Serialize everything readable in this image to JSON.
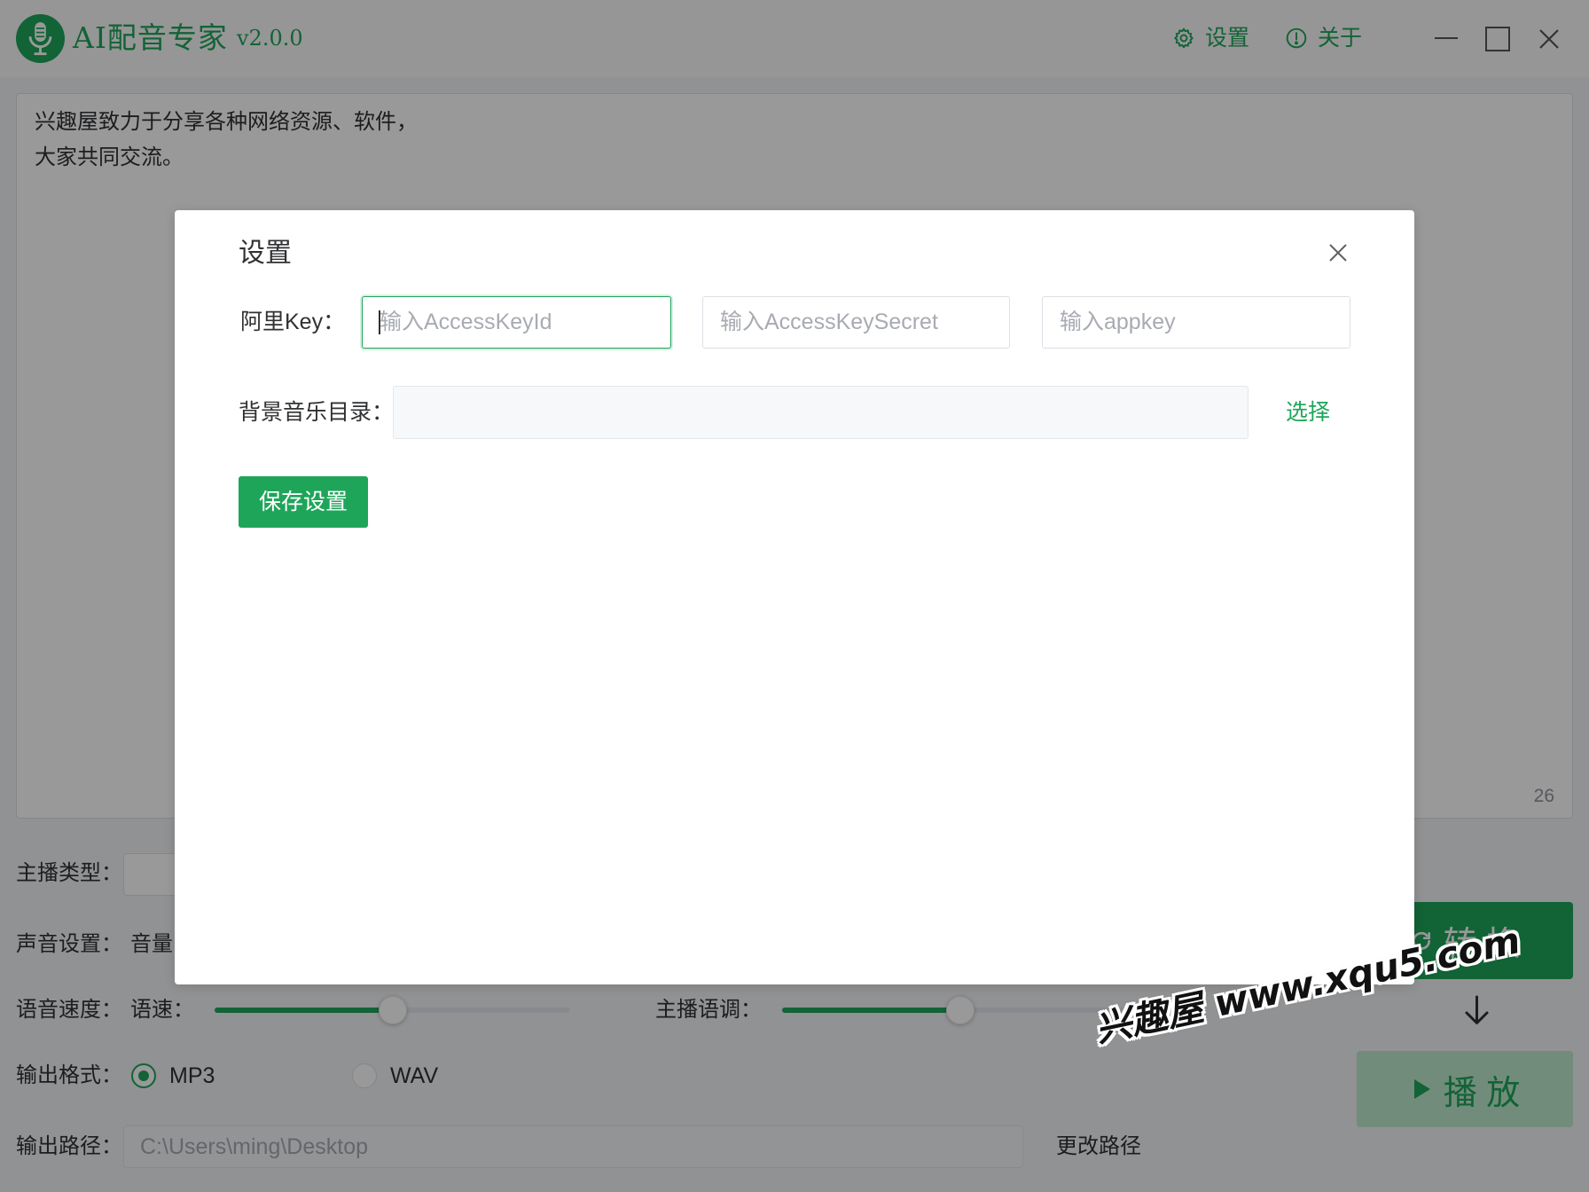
{
  "theme": {
    "accent": "#1fa55a",
    "overlay": "rgba(0,0,0,0.4)"
  },
  "titlebar": {
    "app_name": "AI配音专家",
    "version": "v2.0.0",
    "settings_label": "设置",
    "about_label": "关于",
    "icons": {
      "logo": "microphone-logo-icon",
      "settings": "gear-icon",
      "about": "info-icon",
      "minimize": "minimize-icon",
      "maximize": "maximize-icon",
      "close": "close-icon"
    }
  },
  "editor": {
    "lines": [
      "兴趣屋致力于分享各种网络资源、软件，",
      "大家共同交流。"
    ],
    "char_count": "26"
  },
  "controls": {
    "anchor_type_label": "主播类型：",
    "voice_settings_label": "声音设置：",
    "volume_label": "音量",
    "speech_speed_label": "语音速度：",
    "rate_label": "语速：",
    "rate_level": 0.5,
    "pitch_label": "主播语调：",
    "pitch_level": 0.5,
    "output_format_label": "输出格式：",
    "formats": [
      {
        "label": "MP3",
        "selected": true
      },
      {
        "label": "WAV",
        "selected": false
      }
    ],
    "output_path_label": "输出路径：",
    "output_path": "C:\\Users\\ming\\Desktop",
    "change_path_label": "更改路径",
    "convert_label": "转 换",
    "play_label": "播 放",
    "icons": {
      "convert": "convert-icon",
      "flow": "arrow-down-icon",
      "play": "play-icon"
    }
  },
  "dialog": {
    "title": "设置",
    "ali_key_label": "阿里Key：",
    "access_key_id_placeholder": "输入AccessKeyId",
    "access_key_secret_placeholder": "输入AccessKeySecret",
    "appkey_placeholder": "输入appkey",
    "bgm_dir_label": "背景音乐目录：",
    "choose_label": "选择",
    "save_label": "保存设置",
    "icons": {
      "close": "close-icon"
    }
  },
  "watermark": {
    "text": "兴趣屋 www.xqu5.com"
  }
}
